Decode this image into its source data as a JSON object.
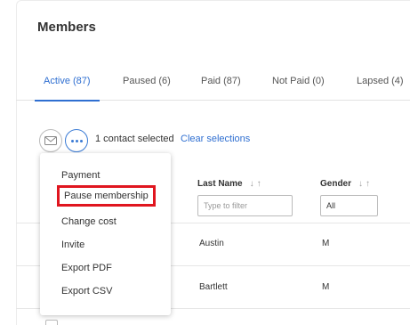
{
  "page": {
    "title": "Members"
  },
  "tabs": [
    {
      "label": "Active (87)",
      "active": true
    },
    {
      "label": "Paused (6)",
      "active": false
    },
    {
      "label": "Paid (87)",
      "active": false
    },
    {
      "label": "Not Paid (0)",
      "active": false
    },
    {
      "label": "Lapsed (4)",
      "active": false
    }
  ],
  "toolbar": {
    "email_icon": "envelope-icon",
    "more_icon": "more-horizontal-icon",
    "selection_text": "1 contact selected",
    "clear_label": "Clear selections"
  },
  "columns": {
    "last_name": {
      "label": "Last Name",
      "filter_placeholder": "Type to filter"
    },
    "gender": {
      "label": "Gender",
      "filter_value": "All"
    },
    "sort_icons": [
      "arrow-down-icon",
      "arrow-up-icon"
    ],
    "sort_glyphs": {
      "down": "↓",
      "up": "↑"
    }
  },
  "rows": [
    {
      "last_name": "Austin",
      "gender": "M"
    },
    {
      "last_name": "Bartlett",
      "gender": "M"
    }
  ],
  "menu": {
    "items": [
      {
        "label": "Payment"
      },
      {
        "label": "Pause membership",
        "highlighted": true
      },
      {
        "label": "Change cost"
      },
      {
        "label": "Invite"
      },
      {
        "label": "Export PDF"
      },
      {
        "label": "Export CSV"
      }
    ]
  },
  "colors": {
    "accent": "#2f6fd1",
    "highlight_border": "#e0161f"
  }
}
